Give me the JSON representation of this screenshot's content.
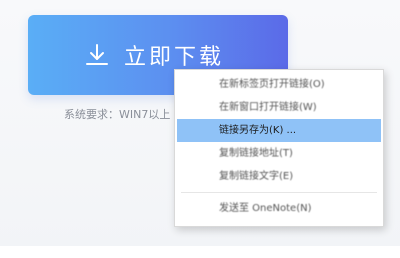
{
  "download": {
    "label": "立即下载",
    "icon": "download-arrow-icon"
  },
  "system_requirement": "系统要求：WIN7以上",
  "context_menu": {
    "items": [
      {
        "label": "在新标签页打开链接(O)"
      },
      {
        "label": "在新窗口打开链接(W)"
      },
      {
        "label": "链接另存为(K) ..."
      },
      {
        "label": "复制链接地址(T)"
      },
      {
        "label": "复制链接文字(E)"
      },
      {
        "label": "发送至 OneNote(N)"
      }
    ],
    "highlight_color": "#8fc2f7"
  },
  "colors": {
    "button_gradient_start": "#5aaef6",
    "button_gradient_end": "#5b6ae8"
  }
}
